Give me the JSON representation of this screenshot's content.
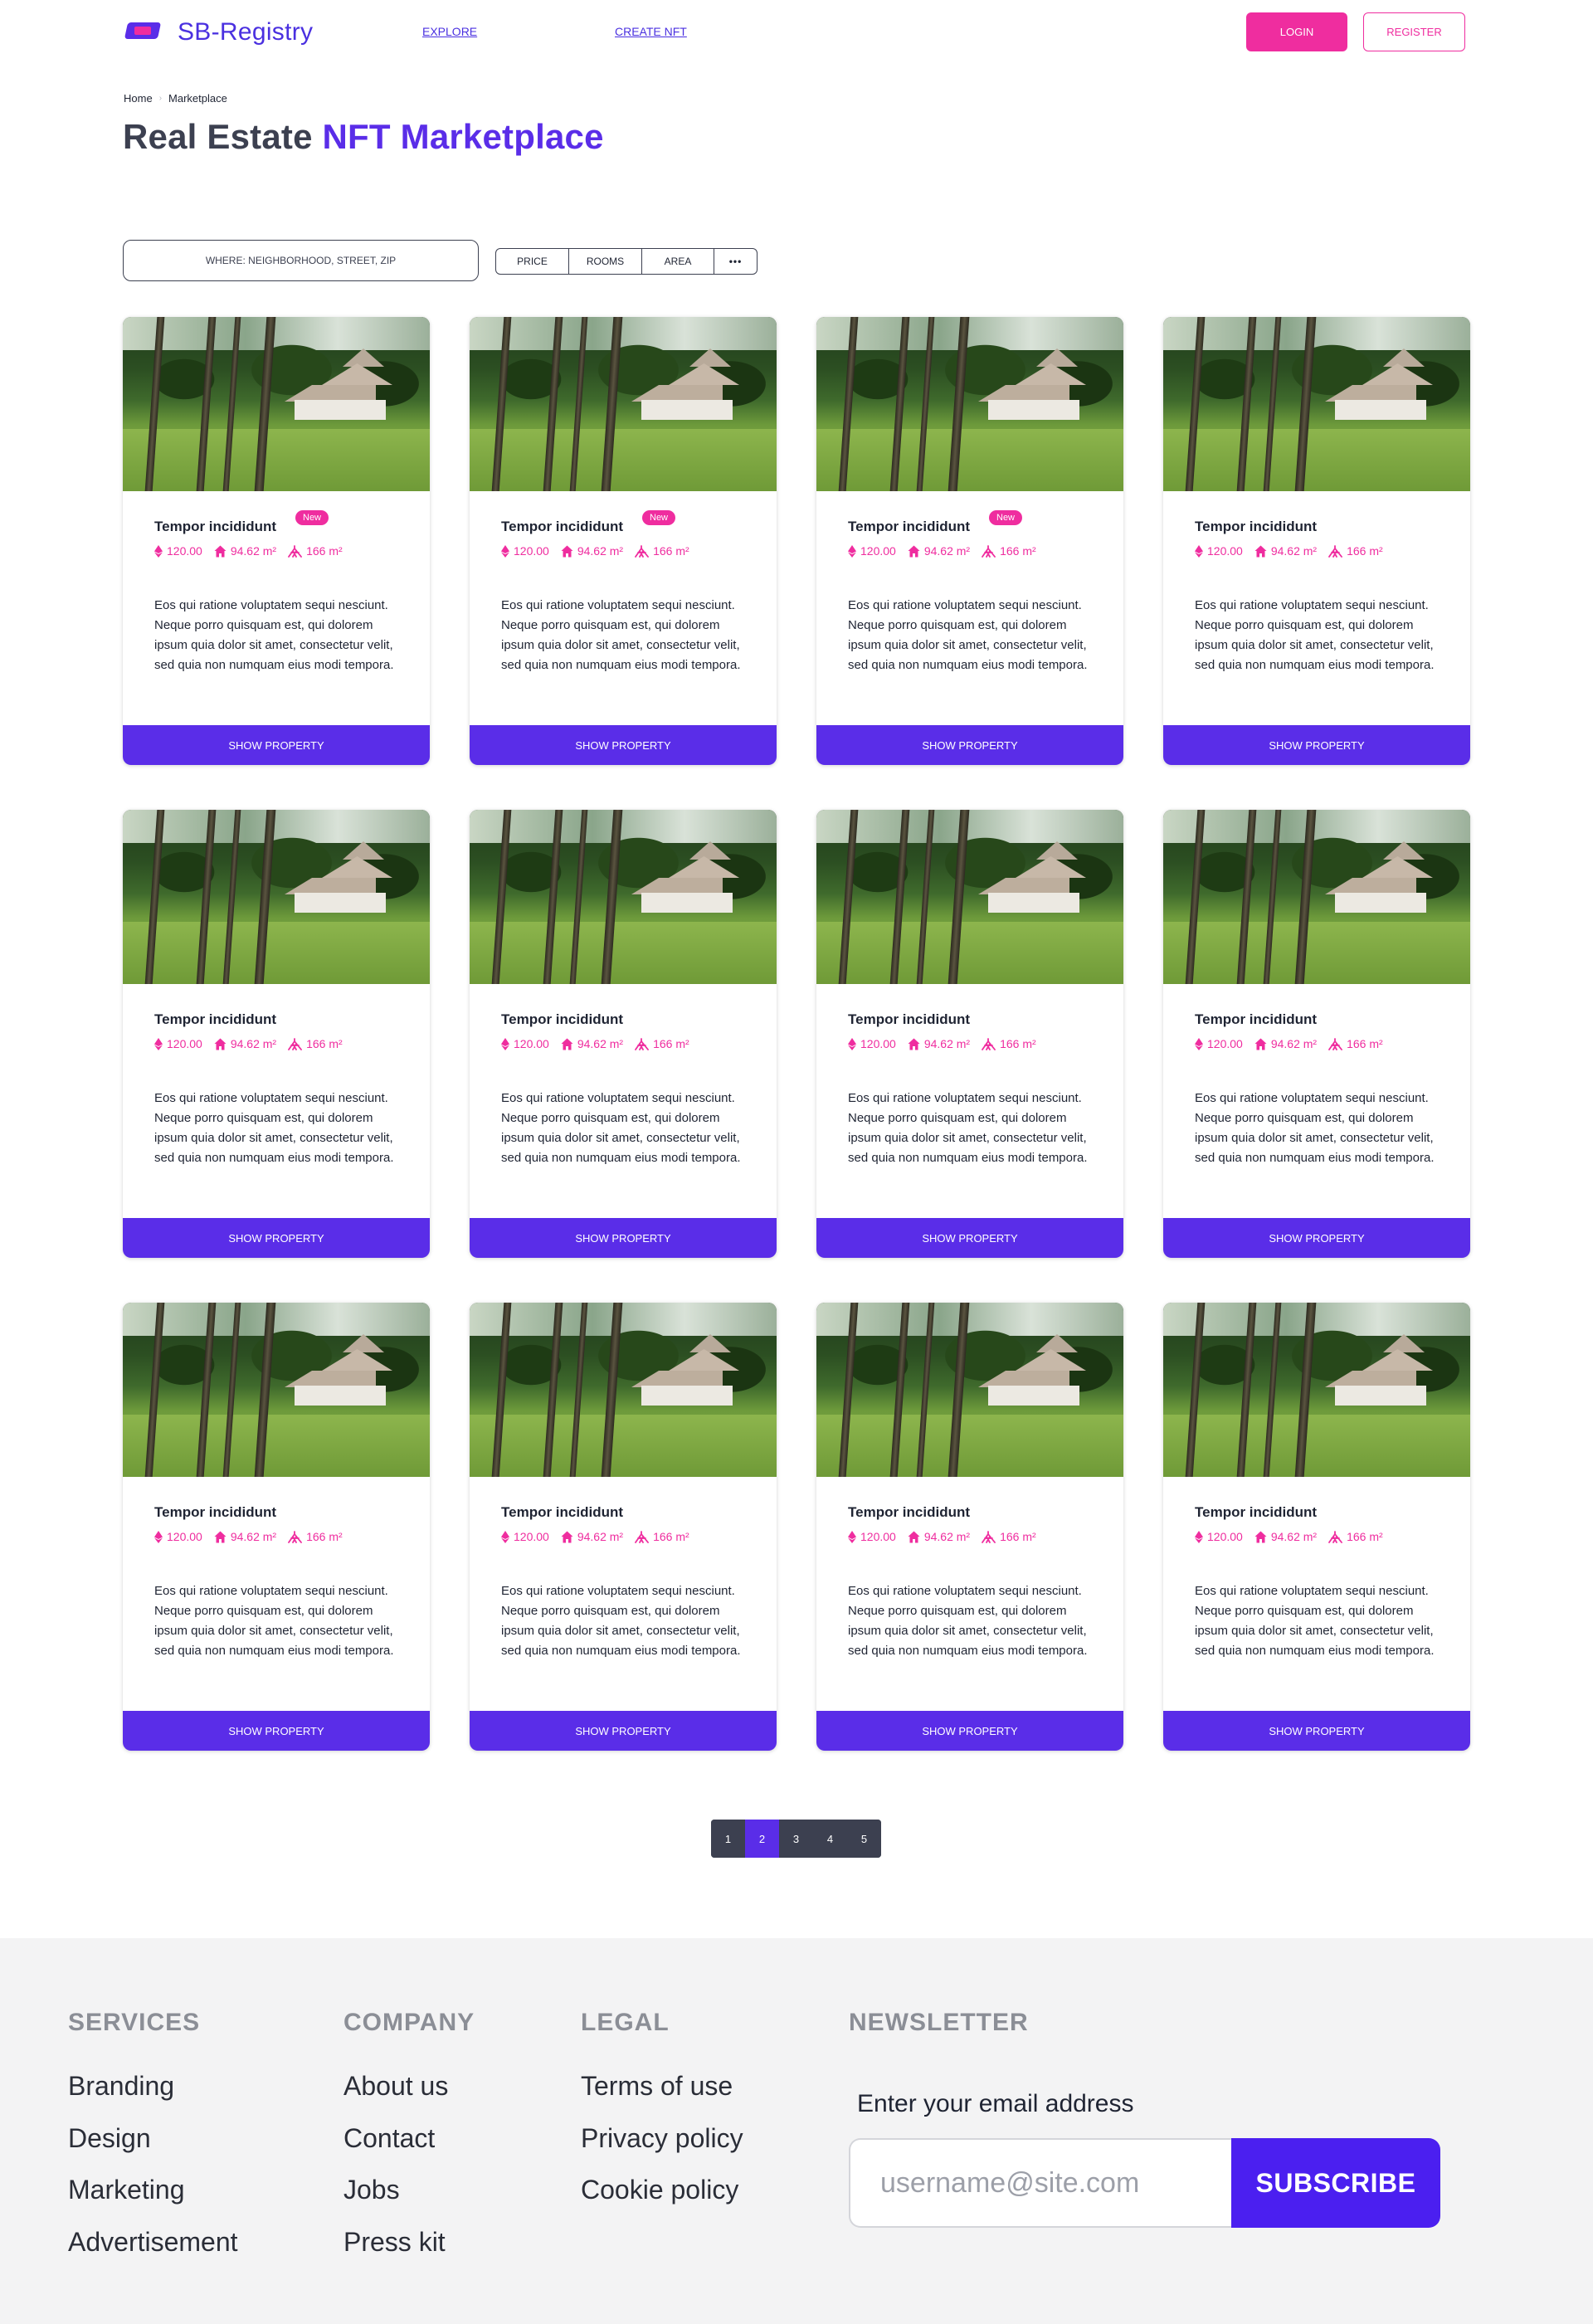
{
  "header": {
    "logo_text": "SB-Registry",
    "nav": [
      "EXPLORE",
      "CREATE NFT"
    ],
    "login": "LOGIN",
    "register": "REGISTER"
  },
  "breadcrumb": {
    "home": "Home",
    "current": "Marketplace"
  },
  "title": {
    "main": "Real Estate",
    "accent": "NFT Marketplace"
  },
  "search": {
    "placeholder": "WHERE: NEIGHBORHOOD, STREET, ZIP"
  },
  "filters": [
    "PRICE",
    "ROOMS",
    "AREA",
    "•••"
  ],
  "cards": [
    {
      "title": "Tempor incididunt",
      "badge": "New",
      "price": "120.00",
      "living": "94.62 m²",
      "lot": "166 m²",
      "description": "Eos qui ratione voluptatem sequi nesciunt. Neque porro quisquam est, qui dolorem ipsum quia dolor sit amet, consectetur velit, sed quia non numquam eius modi tempora.",
      "button": "SHOW PROPERTY"
    },
    {
      "title": "Tempor incididunt",
      "badge": "New",
      "price": "120.00",
      "living": "94.62 m²",
      "lot": "166 m²",
      "description": "Eos qui ratione voluptatem sequi nesciunt. Neque porro quisquam est, qui dolorem ipsum quia dolor sit amet, consectetur velit, sed quia non numquam eius modi tempora.",
      "button": "SHOW PROPERTY"
    },
    {
      "title": "Tempor incididunt",
      "badge": "New",
      "price": "120.00",
      "living": "94.62 m²",
      "lot": "166 m²",
      "description": "Eos qui ratione voluptatem sequi nesciunt. Neque porro quisquam est, qui dolorem ipsum quia dolor sit amet, consectetur velit, sed quia non numquam eius modi tempora.",
      "button": "SHOW PROPERTY"
    },
    {
      "title": "Tempor incididunt",
      "badge": "",
      "price": "120.00",
      "living": "94.62 m²",
      "lot": "166 m²",
      "description": "Eos qui ratione voluptatem sequi nesciunt. Neque porro quisquam est, qui dolorem ipsum quia dolor sit amet, consectetur velit, sed quia non numquam eius modi tempora.",
      "button": "SHOW PROPERTY"
    },
    {
      "title": "Tempor incididunt",
      "badge": "",
      "price": "120.00",
      "living": "94.62 m²",
      "lot": "166 m²",
      "description": "Eos qui ratione voluptatem sequi nesciunt. Neque porro quisquam est, qui dolorem ipsum quia dolor sit amet, consectetur velit, sed quia non numquam eius modi tempora.",
      "button": "SHOW PROPERTY"
    },
    {
      "title": "Tempor incididunt",
      "badge": "",
      "price": "120.00",
      "living": "94.62 m²",
      "lot": "166 m²",
      "description": "Eos qui ratione voluptatem sequi nesciunt. Neque porro quisquam est, qui dolorem ipsum quia dolor sit amet, consectetur velit, sed quia non numquam eius modi tempora.",
      "button": "SHOW PROPERTY"
    },
    {
      "title": "Tempor incididunt",
      "badge": "",
      "price": "120.00",
      "living": "94.62 m²",
      "lot": "166 m²",
      "description": "Eos qui ratione voluptatem sequi nesciunt. Neque porro quisquam est, qui dolorem ipsum quia dolor sit amet, consectetur velit, sed quia non numquam eius modi tempora.",
      "button": "SHOW PROPERTY"
    },
    {
      "title": "Tempor incididunt",
      "badge": "",
      "price": "120.00",
      "living": "94.62 m²",
      "lot": "166 m²",
      "description": "Eos qui ratione voluptatem sequi nesciunt. Neque porro quisquam est, qui dolorem ipsum quia dolor sit amet, consectetur velit, sed quia non numquam eius modi tempora.",
      "button": "SHOW PROPERTY"
    },
    {
      "title": "Tempor incididunt",
      "badge": "",
      "price": "120.00",
      "living": "94.62 m²",
      "lot": "166 m²",
      "description": "Eos qui ratione voluptatem sequi nesciunt. Neque porro quisquam est, qui dolorem ipsum quia dolor sit amet, consectetur velit, sed quia non numquam eius modi tempora.",
      "button": "SHOW PROPERTY"
    },
    {
      "title": "Tempor incididunt",
      "badge": "",
      "price": "120.00",
      "living": "94.62 m²",
      "lot": "166 m²",
      "description": "Eos qui ratione voluptatem sequi nesciunt. Neque porro quisquam est, qui dolorem ipsum quia dolor sit amet, consectetur velit, sed quia non numquam eius modi tempora.",
      "button": "SHOW PROPERTY"
    },
    {
      "title": "Tempor incididunt",
      "badge": "",
      "price": "120.00",
      "living": "94.62 m²",
      "lot": "166 m²",
      "description": "Eos qui ratione voluptatem sequi nesciunt. Neque porro quisquam est, qui dolorem ipsum quia dolor sit amet, consectetur velit, sed quia non numquam eius modi tempora.",
      "button": "SHOW PROPERTY"
    },
    {
      "title": "Tempor incididunt",
      "badge": "",
      "price": "120.00",
      "living": "94.62 m²",
      "lot": "166 m²",
      "description": "Eos qui ratione voluptatem sequi nesciunt. Neque porro quisquam est, qui dolorem ipsum quia dolor sit amet, consectetur velit, sed quia non numquam eius modi tempora.",
      "button": "SHOW PROPERTY"
    }
  ],
  "card_icons": [
    "ethereum-icon",
    "home-icon",
    "area-icon"
  ],
  "pagination": {
    "pages": [
      "1",
      "2",
      "3",
      "4",
      "5"
    ],
    "active": "2"
  },
  "footer": {
    "services": {
      "heading": "SERVICES",
      "links": [
        "Branding",
        "Design",
        "Marketing",
        "Advertisement"
      ]
    },
    "company": {
      "heading": "COMPANY",
      "links": [
        "About us",
        "Contact",
        "Jobs",
        "Press kit"
      ]
    },
    "legal": {
      "heading": "LEGAL",
      "links": [
        "Terms of use",
        "Privacy policy",
        "Cookie policy"
      ]
    },
    "newsletter": {
      "heading": "NEWSLETTER",
      "label": "Enter your email address",
      "placeholder": "username@site.com",
      "button": "SUBSCRIBE"
    }
  },
  "colors": {
    "primary": "#5a2de8",
    "accent": "#ef2d9f",
    "text": "#1f2433",
    "footer_bg": "#f3f3f4"
  }
}
